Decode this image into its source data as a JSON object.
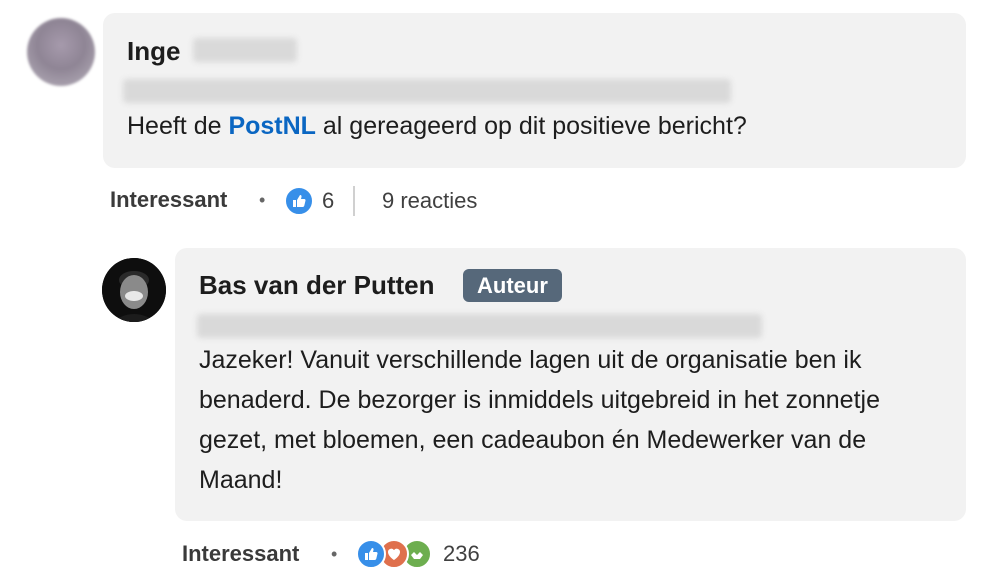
{
  "comment1": {
    "author_first": "Inge",
    "text_before": "Heeft de ",
    "mention": "PostNL",
    "text_after": " al gereageerd op dit positieve bericht?",
    "react_label": "Interessant",
    "reaction_count": "6",
    "replies": "9 reacties"
  },
  "comment2": {
    "author": "Bas van der Putten",
    "badge": "Auteur",
    "text": "Jazeker! Vanuit verschillende lagen uit de organisatie ben ik benaderd. De bezorger is inmiddels uitgebreid in het zonnetje gezet, met bloemen, een cadeaubon én Medewerker van de Maand!",
    "react_label": "Interessant",
    "reaction_count": "236"
  },
  "reaction_icons": [
    "like-icon",
    "love-icon",
    "support-icon"
  ],
  "colors": {
    "mention": "#0a66c2",
    "badge": "#56687a",
    "like": "#378fe9",
    "love": "#df704d",
    "support": "#6dae4f"
  }
}
